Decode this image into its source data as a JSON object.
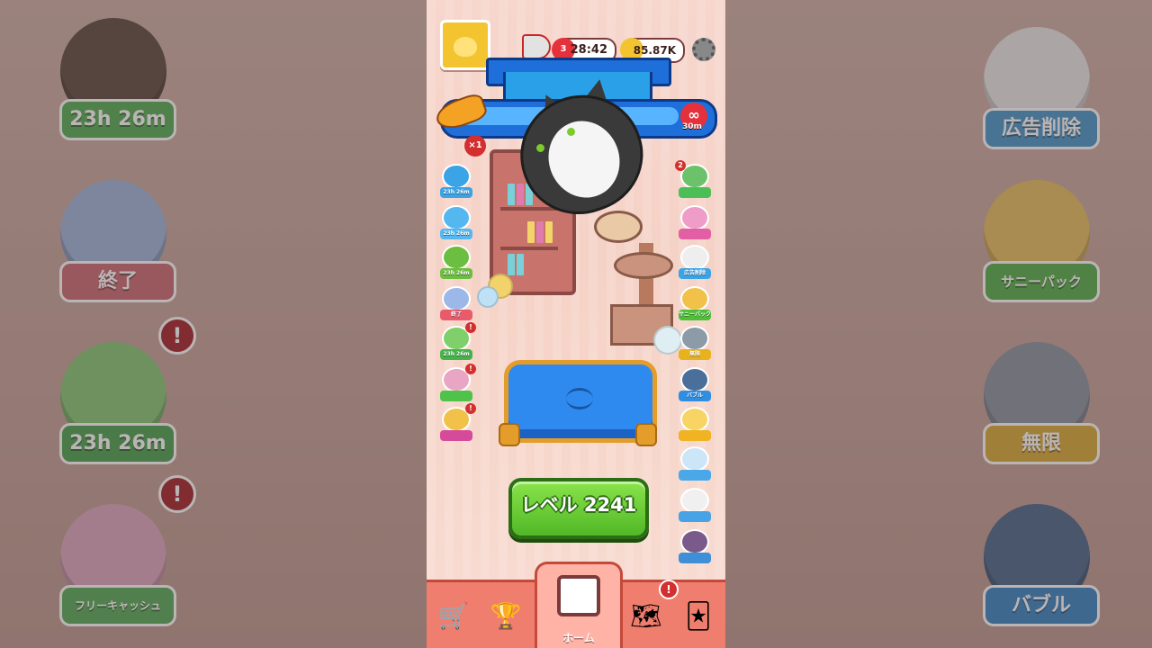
{
  "hud": {
    "timer": "28:42",
    "timer_hearts": "3",
    "coins": "85.87K",
    "fish_count": "×1",
    "infinite_symbol": "∞",
    "infinite_time": "30m"
  },
  "level_button": {
    "label": "レベル 2241"
  },
  "left_icons": [
    {
      "name": "event-1",
      "label": "23h 26m",
      "color": "#3aa4e6",
      "badge": ""
    },
    {
      "name": "event-2",
      "label": "23h 26m",
      "color": "#55b7f0",
      "badge": ""
    },
    {
      "name": "event-3",
      "label": "23h 26m",
      "color": "#6bbe3f",
      "badge": ""
    },
    {
      "name": "event-4",
      "label": "終了",
      "color": "#e95b6a",
      "badge": ""
    },
    {
      "name": "event-5",
      "label": "23h 26m",
      "color": "#46b34a",
      "badge": "!"
    },
    {
      "name": "event-6",
      "label": "",
      "color": "#4fc24a",
      "badge": "!"
    },
    {
      "name": "event-7",
      "label": "",
      "color": "#d64a9a",
      "badge": "!"
    }
  ],
  "right_icons": [
    {
      "name": "offer-1",
      "label": "",
      "color": "#4bbf55",
      "badge": "2"
    },
    {
      "name": "offer-2",
      "label": "",
      "color": "#e35fa4",
      "badge": ""
    },
    {
      "name": "offer-3",
      "label": "広告削除",
      "color": "#3aa4e6",
      "badge": ""
    },
    {
      "name": "offer-4",
      "label": "サニーパック",
      "color": "#4fbf3a",
      "badge": ""
    },
    {
      "name": "offer-5",
      "label": "無限",
      "color": "#e8b21f",
      "badge": ""
    },
    {
      "name": "offer-6",
      "label": "バブル",
      "color": "#2f8ee0",
      "badge": ""
    },
    {
      "name": "offer-7",
      "label": "",
      "color": "#f0b323",
      "badge": ""
    },
    {
      "name": "offer-8",
      "label": "",
      "color": "#4aa8e8",
      "badge": ""
    },
    {
      "name": "offer-9",
      "label": "",
      "color": "#47a3e6",
      "badge": ""
    },
    {
      "name": "offer-10",
      "label": "",
      "color": "#3e8fd8",
      "badge": ""
    }
  ],
  "backdrop_left": [
    {
      "label": "23h 26m",
      "color": "#4bb94a"
    },
    {
      "label": "終了",
      "color": "#e36a76"
    },
    {
      "label": "23h 26m",
      "color": "#3fae45"
    },
    {
      "label": "フリーキャッシュ",
      "color": "#4db450"
    }
  ],
  "backdrop_right": [
    {
      "label": "広告削除",
      "color": "#3c9fe0"
    },
    {
      "label": "サニーパック",
      "color": "#4ab83e"
    },
    {
      "label": "無限",
      "color": "#e5ad1d"
    },
    {
      "label": "バブル",
      "color": "#2e8ede"
    }
  ],
  "nav": {
    "home_label": "ホーム",
    "alert": "!"
  },
  "colors": {
    "accent_green": "#51b827",
    "nav_bar": "#f07e6e",
    "cushion_blue": "#2f8af0"
  }
}
